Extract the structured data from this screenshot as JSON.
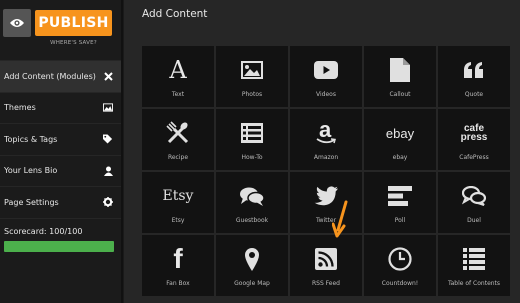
{
  "header": {
    "publish_label": "PUBLISH",
    "wheres_save_label": "WHERE'S SAVE?"
  },
  "sidebar": {
    "items": [
      {
        "label": "Add Content (Modules)",
        "icon": "close-icon"
      },
      {
        "label": "Themes",
        "icon": "image-icon"
      },
      {
        "label": "Topics & Tags",
        "icon": "tag-icon"
      },
      {
        "label": "Your Lens Bio",
        "icon": "user-icon"
      },
      {
        "label": "Page Settings",
        "icon": "gear-icon"
      }
    ],
    "scorecard": {
      "label": "Scorecard: 100/100",
      "value": 100,
      "max": 100,
      "color": "#4cb04c"
    }
  },
  "main": {
    "title": "Add Content",
    "tiles": [
      {
        "label": "Text",
        "icon": "text-icon"
      },
      {
        "label": "Photos",
        "icon": "photo-icon"
      },
      {
        "label": "Videos",
        "icon": "youtube-icon"
      },
      {
        "label": "Callout",
        "icon": "callout-icon"
      },
      {
        "label": "Quote",
        "icon": "quote-icon"
      },
      {
        "label": "Recipe",
        "icon": "fork-knife-icon"
      },
      {
        "label": "How-To",
        "icon": "list-icon"
      },
      {
        "label": "Amazon",
        "icon": "amazon-icon",
        "glyph": "a"
      },
      {
        "label": "ebay",
        "icon": "ebay-icon",
        "glyph": "ebay"
      },
      {
        "label": "CafePress",
        "icon": "cafepress-icon",
        "glyph": "cafe press"
      },
      {
        "label": "Etsy",
        "icon": "etsy-icon",
        "glyph": "Etsy"
      },
      {
        "label": "Guestbook",
        "icon": "chat-bubbles-icon"
      },
      {
        "label": "Twitter",
        "icon": "twitter-icon"
      },
      {
        "label": "Poll",
        "icon": "poll-icon"
      },
      {
        "label": "Duel",
        "icon": "duel-icon"
      },
      {
        "label": "Fan Box",
        "icon": "facebook-icon",
        "glyph": "f"
      },
      {
        "label": "Google Map",
        "icon": "map-pin-icon"
      },
      {
        "label": "RSS Feed",
        "icon": "rss-icon"
      },
      {
        "label": "Countdown!",
        "icon": "clock-icon"
      },
      {
        "label": "Table of Contents",
        "icon": "toc-icon"
      }
    ]
  },
  "colors": {
    "accent": "#f7941d",
    "background": "#262626",
    "tile": "#121212"
  }
}
